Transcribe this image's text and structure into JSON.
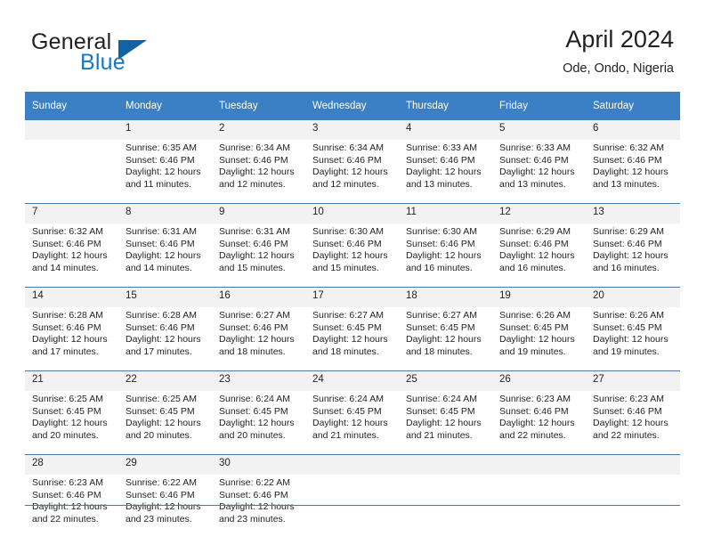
{
  "brand": {
    "name_part1": "General",
    "name_part2": "Blue",
    "accent_color": "#1878be",
    "triangle_color": "#1263a4",
    "logo_icon": "triangle-flag-icon"
  },
  "header": {
    "title": "April 2024",
    "subtitle": "Ode, Ondo, Nigeria"
  },
  "calendar": {
    "header_bg": "#3b7fc4",
    "daynum_bg": "#f2f2f2",
    "grid_line": "#4a79a8",
    "weekdays": [
      "Sunday",
      "Monday",
      "Tuesday",
      "Wednesday",
      "Thursday",
      "Friday",
      "Saturday"
    ],
    "weeks": [
      [
        {
          "day": "",
          "sunrise": "",
          "sunset": "",
          "daylight1": "",
          "daylight2": ""
        },
        {
          "day": "1",
          "sunrise": "Sunrise: 6:35 AM",
          "sunset": "Sunset: 6:46 PM",
          "daylight1": "Daylight: 12 hours",
          "daylight2": "and 11 minutes."
        },
        {
          "day": "2",
          "sunrise": "Sunrise: 6:34 AM",
          "sunset": "Sunset: 6:46 PM",
          "daylight1": "Daylight: 12 hours",
          "daylight2": "and 12 minutes."
        },
        {
          "day": "3",
          "sunrise": "Sunrise: 6:34 AM",
          "sunset": "Sunset: 6:46 PM",
          "daylight1": "Daylight: 12 hours",
          "daylight2": "and 12 minutes."
        },
        {
          "day": "4",
          "sunrise": "Sunrise: 6:33 AM",
          "sunset": "Sunset: 6:46 PM",
          "daylight1": "Daylight: 12 hours",
          "daylight2": "and 13 minutes."
        },
        {
          "day": "5",
          "sunrise": "Sunrise: 6:33 AM",
          "sunset": "Sunset: 6:46 PM",
          "daylight1": "Daylight: 12 hours",
          "daylight2": "and 13 minutes."
        },
        {
          "day": "6",
          "sunrise": "Sunrise: 6:32 AM",
          "sunset": "Sunset: 6:46 PM",
          "daylight1": "Daylight: 12 hours",
          "daylight2": "and 13 minutes."
        }
      ],
      [
        {
          "day": "7",
          "sunrise": "Sunrise: 6:32 AM",
          "sunset": "Sunset: 6:46 PM",
          "daylight1": "Daylight: 12 hours",
          "daylight2": "and 14 minutes."
        },
        {
          "day": "8",
          "sunrise": "Sunrise: 6:31 AM",
          "sunset": "Sunset: 6:46 PM",
          "daylight1": "Daylight: 12 hours",
          "daylight2": "and 14 minutes."
        },
        {
          "day": "9",
          "sunrise": "Sunrise: 6:31 AM",
          "sunset": "Sunset: 6:46 PM",
          "daylight1": "Daylight: 12 hours",
          "daylight2": "and 15 minutes."
        },
        {
          "day": "10",
          "sunrise": "Sunrise: 6:30 AM",
          "sunset": "Sunset: 6:46 PM",
          "daylight1": "Daylight: 12 hours",
          "daylight2": "and 15 minutes."
        },
        {
          "day": "11",
          "sunrise": "Sunrise: 6:30 AM",
          "sunset": "Sunset: 6:46 PM",
          "daylight1": "Daylight: 12 hours",
          "daylight2": "and 16 minutes."
        },
        {
          "day": "12",
          "sunrise": "Sunrise: 6:29 AM",
          "sunset": "Sunset: 6:46 PM",
          "daylight1": "Daylight: 12 hours",
          "daylight2": "and 16 minutes."
        },
        {
          "day": "13",
          "sunrise": "Sunrise: 6:29 AM",
          "sunset": "Sunset: 6:46 PM",
          "daylight1": "Daylight: 12 hours",
          "daylight2": "and 16 minutes."
        }
      ],
      [
        {
          "day": "14",
          "sunrise": "Sunrise: 6:28 AM",
          "sunset": "Sunset: 6:46 PM",
          "daylight1": "Daylight: 12 hours",
          "daylight2": "and 17 minutes."
        },
        {
          "day": "15",
          "sunrise": "Sunrise: 6:28 AM",
          "sunset": "Sunset: 6:46 PM",
          "daylight1": "Daylight: 12 hours",
          "daylight2": "and 17 minutes."
        },
        {
          "day": "16",
          "sunrise": "Sunrise: 6:27 AM",
          "sunset": "Sunset: 6:46 PM",
          "daylight1": "Daylight: 12 hours",
          "daylight2": "and 18 minutes."
        },
        {
          "day": "17",
          "sunrise": "Sunrise: 6:27 AM",
          "sunset": "Sunset: 6:45 PM",
          "daylight1": "Daylight: 12 hours",
          "daylight2": "and 18 minutes."
        },
        {
          "day": "18",
          "sunrise": "Sunrise: 6:27 AM",
          "sunset": "Sunset: 6:45 PM",
          "daylight1": "Daylight: 12 hours",
          "daylight2": "and 18 minutes."
        },
        {
          "day": "19",
          "sunrise": "Sunrise: 6:26 AM",
          "sunset": "Sunset: 6:45 PM",
          "daylight1": "Daylight: 12 hours",
          "daylight2": "and 19 minutes."
        },
        {
          "day": "20",
          "sunrise": "Sunrise: 6:26 AM",
          "sunset": "Sunset: 6:45 PM",
          "daylight1": "Daylight: 12 hours",
          "daylight2": "and 19 minutes."
        }
      ],
      [
        {
          "day": "21",
          "sunrise": "Sunrise: 6:25 AM",
          "sunset": "Sunset: 6:45 PM",
          "daylight1": "Daylight: 12 hours",
          "daylight2": "and 20 minutes."
        },
        {
          "day": "22",
          "sunrise": "Sunrise: 6:25 AM",
          "sunset": "Sunset: 6:45 PM",
          "daylight1": "Daylight: 12 hours",
          "daylight2": "and 20 minutes."
        },
        {
          "day": "23",
          "sunrise": "Sunrise: 6:24 AM",
          "sunset": "Sunset: 6:45 PM",
          "daylight1": "Daylight: 12 hours",
          "daylight2": "and 20 minutes."
        },
        {
          "day": "24",
          "sunrise": "Sunrise: 6:24 AM",
          "sunset": "Sunset: 6:45 PM",
          "daylight1": "Daylight: 12 hours",
          "daylight2": "and 21 minutes."
        },
        {
          "day": "25",
          "sunrise": "Sunrise: 6:24 AM",
          "sunset": "Sunset: 6:45 PM",
          "daylight1": "Daylight: 12 hours",
          "daylight2": "and 21 minutes."
        },
        {
          "day": "26",
          "sunrise": "Sunrise: 6:23 AM",
          "sunset": "Sunset: 6:46 PM",
          "daylight1": "Daylight: 12 hours",
          "daylight2": "and 22 minutes."
        },
        {
          "day": "27",
          "sunrise": "Sunrise: 6:23 AM",
          "sunset": "Sunset: 6:46 PM",
          "daylight1": "Daylight: 12 hours",
          "daylight2": "and 22 minutes."
        }
      ],
      [
        {
          "day": "28",
          "sunrise": "Sunrise: 6:23 AM",
          "sunset": "Sunset: 6:46 PM",
          "daylight1": "Daylight: 12 hours",
          "daylight2": "and 22 minutes."
        },
        {
          "day": "29",
          "sunrise": "Sunrise: 6:22 AM",
          "sunset": "Sunset: 6:46 PM",
          "daylight1": "Daylight: 12 hours",
          "daylight2": "and 23 minutes."
        },
        {
          "day": "30",
          "sunrise": "Sunrise: 6:22 AM",
          "sunset": "Sunset: 6:46 PM",
          "daylight1": "Daylight: 12 hours",
          "daylight2": "and 23 minutes."
        },
        {
          "day": "",
          "sunrise": "",
          "sunset": "",
          "daylight1": "",
          "daylight2": ""
        },
        {
          "day": "",
          "sunrise": "",
          "sunset": "",
          "daylight1": "",
          "daylight2": ""
        },
        {
          "day": "",
          "sunrise": "",
          "sunset": "",
          "daylight1": "",
          "daylight2": ""
        },
        {
          "day": "",
          "sunrise": "",
          "sunset": "",
          "daylight1": "",
          "daylight2": ""
        }
      ]
    ]
  }
}
